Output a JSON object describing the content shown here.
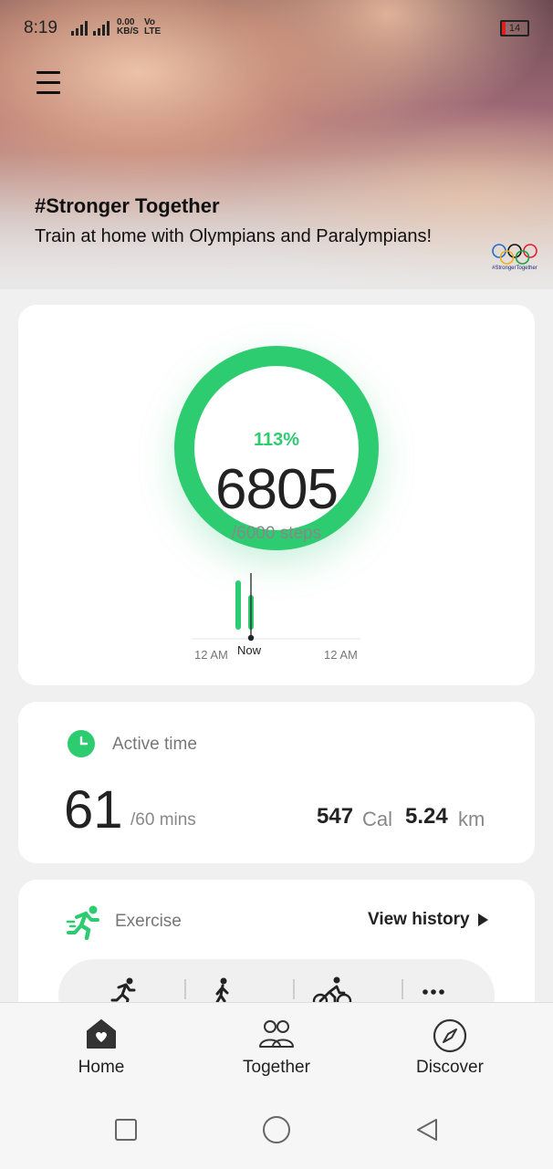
{
  "status_bar": {
    "time": "8:19",
    "net_speed_value": "0.00",
    "net_speed_unit": "KB/S",
    "volte": "Vo LTE",
    "battery": "14",
    "battery_level": 0.14,
    "battery_color": "#e02020"
  },
  "hero": {
    "title": "#Stronger Together",
    "subtitle": "Train at home with Olympians and Paralympians!",
    "logo_caption": "#StrongerTogether"
  },
  "steps": {
    "percent": "113%",
    "count": "6805",
    "goal": "/6000 steps",
    "progress": 1.13,
    "ring_color": "#2ecc71",
    "chart_left_label": "12 AM",
    "chart_now_label": "Now",
    "chart_right_label": "12 AM"
  },
  "active_time": {
    "label": "Active time",
    "value": "61",
    "goal": "/60 mins",
    "calories": "547",
    "calories_unit": "Cal",
    "distance": "5.24",
    "distance_unit": "km"
  },
  "exercise": {
    "label": "Exercise",
    "view_history": "View history",
    "shortcuts": [
      "running-icon",
      "walking-icon",
      "cycling-icon",
      "more-icon"
    ]
  },
  "bottom_nav": {
    "tabs": [
      {
        "label": "Home",
        "icon": "home-heart-icon"
      },
      {
        "label": "Together",
        "icon": "people-icon"
      },
      {
        "label": "Discover",
        "icon": "compass-icon"
      }
    ]
  },
  "system_nav": [
    "recent-apps-icon",
    "home-circle-icon",
    "back-icon"
  ]
}
